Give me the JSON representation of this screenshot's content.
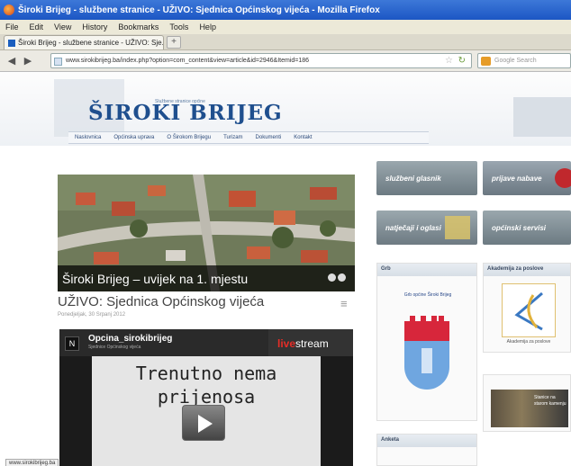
{
  "window": {
    "title": "Široki Brijeg - službene stranice - UŽIVO: Sjednica Općinskog vijeća - Mozilla Firefox"
  },
  "menu": {
    "items": [
      "File",
      "Edit",
      "View",
      "History",
      "Bookmarks",
      "Tools",
      "Help"
    ]
  },
  "tab": {
    "label": "Široki Brijeg - službene stranice - UŽIVO: Sje..."
  },
  "urlbar": {
    "value": "www.sirokibrijeg.ba/index.php?option=com_content&view=article&id=2946&Itemid=186"
  },
  "search": {
    "placeholder": "Google Search"
  },
  "site": {
    "logo": "ŠIROKI BRIJEG",
    "logo_sub": "Službene stranice općine",
    "nav": [
      "Naslovnica",
      "Općinska uprava",
      "O Širokom Brijegu",
      "Turizam",
      "Dokumenti",
      "Kontakt"
    ]
  },
  "hero": {
    "caption": "Široki Brijeg – uvijek na 1. mjestu"
  },
  "post": {
    "title": "UŽIVO: Sjednica Općinskog vijeća",
    "date": "Ponedjeljak, 30 Srpanj 2012"
  },
  "player": {
    "channel": "Opcina_sirokibrijeg",
    "channel_sub": "Sjednice Općinskog vijeća",
    "brand_a": "live",
    "brand_b": "stream",
    "message_line1": "Trenutno nema",
    "message_line2": "prijenosa"
  },
  "status": {
    "text": "www.sirokibrijeg.ba"
  },
  "sidebar": {
    "btn1": "službeni glasnik",
    "btn2": "prijave nabave",
    "btn3": "natječaji i oglasi",
    "btn4": "općinski servisi",
    "panel1": "Grb",
    "panel1_text": "Grb općine Široki Brijeg",
    "panel2": "Akademija za poslove",
    "panel2_text": "Akademija za poslove",
    "panel3_text": "Stanice na starom kamenju",
    "panel4": "Anketa"
  }
}
